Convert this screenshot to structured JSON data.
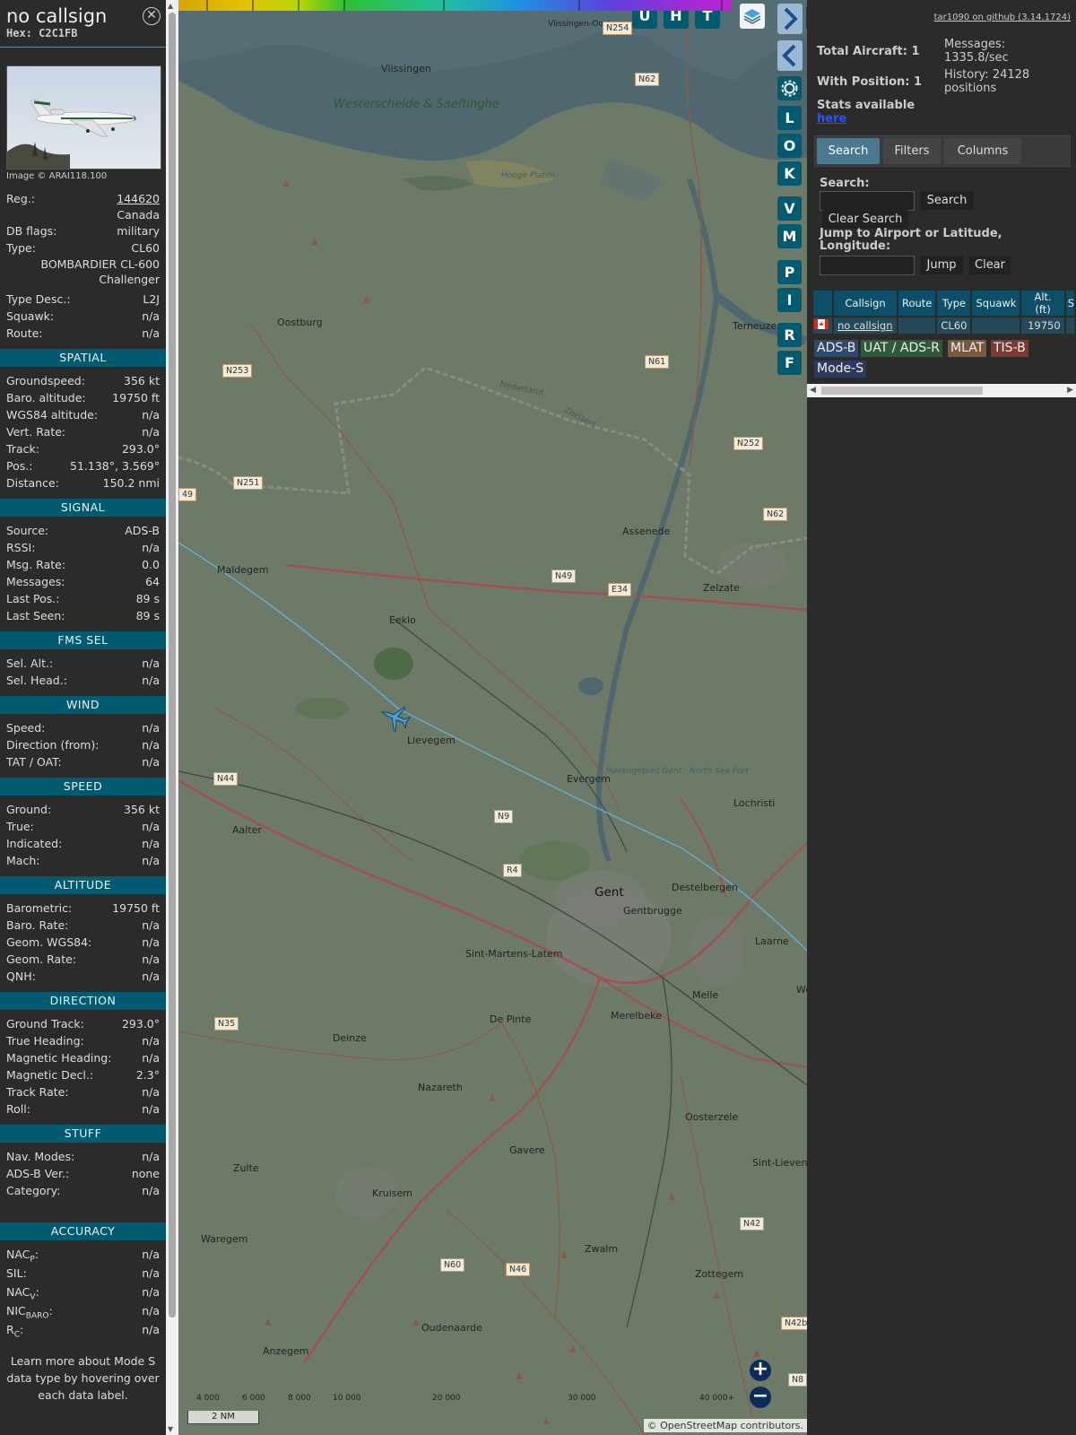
{
  "info": {
    "callsign": "no callsign",
    "hex": "Hex: C2C1FB",
    "image_credit": "Image © ARAI118.100",
    "reg_label": "Reg.:",
    "reg_value": "144620",
    "country": "Canada",
    "dbflags_label": "DB flags:",
    "dbflags_value": "military",
    "type_label": "Type:",
    "type_value": "CL60",
    "type_full": "BOMBARDIER CL-600 Challenger",
    "typedesc_label": "Type Desc.:",
    "typedesc_value": "L2J",
    "squawk_label": "Squawk:",
    "squawk_value": "n/a",
    "route_label": "Route:",
    "route_value": "n/a",
    "sections": {
      "spatial": "SPATIAL",
      "signal": "SIGNAL",
      "fms": "FMS SEL",
      "wind": "WIND",
      "speed": "SPEED",
      "altitude": "ALTITUDE",
      "direction": "DIRECTION",
      "stuff": "STUFF",
      "accuracy": "ACCURACY"
    },
    "spatial": [
      {
        "k": "Groundspeed:",
        "v": "356 kt"
      },
      {
        "k": "Baro. altitude:",
        "v": "19750 ft"
      },
      {
        "k": "WGS84 altitude:",
        "v": "n/a"
      },
      {
        "k": "Vert. Rate:",
        "v": "n/a"
      },
      {
        "k": "Track:",
        "v": "293.0°"
      },
      {
        "k": "Pos.:",
        "v": "51.138°, 3.569°"
      },
      {
        "k": "Distance:",
        "v": "150.2 nmi"
      }
    ],
    "signal": [
      {
        "k": "Source:",
        "v": "ADS-B"
      },
      {
        "k": "RSSI:",
        "v": "n/a"
      },
      {
        "k": "Msg. Rate:",
        "v": "0.0"
      },
      {
        "k": "Messages:",
        "v": "64"
      },
      {
        "k": "Last Pos.:",
        "v": "89 s"
      },
      {
        "k": "Last Seen:",
        "v": "89 s"
      }
    ],
    "fms": [
      {
        "k": "Sel. Alt.:",
        "v": "n/a"
      },
      {
        "k": "Sel. Head.:",
        "v": "n/a"
      }
    ],
    "wind": [
      {
        "k": "Speed:",
        "v": "n/a"
      },
      {
        "k": "Direction (from):",
        "v": "n/a"
      },
      {
        "k": "TAT / OAT:",
        "v": "n/a"
      }
    ],
    "speed": [
      {
        "k": "Ground:",
        "v": "356 kt"
      },
      {
        "k": "True:",
        "v": "n/a"
      },
      {
        "k": "Indicated:",
        "v": "n/a"
      },
      {
        "k": "Mach:",
        "v": "n/a"
      }
    ],
    "altitude": [
      {
        "k": "Barometric:",
        "v": "19750 ft"
      },
      {
        "k": "Baro. Rate:",
        "v": "n/a"
      },
      {
        "k": "Geom. WGS84:",
        "v": "n/a"
      },
      {
        "k": "Geom. Rate:",
        "v": "n/a"
      },
      {
        "k": "QNH:",
        "v": "n/a"
      }
    ],
    "direction": [
      {
        "k": "Ground Track:",
        "v": "293.0°"
      },
      {
        "k": "True Heading:",
        "v": "n/a"
      },
      {
        "k": "Magnetic Heading:",
        "v": "n/a"
      },
      {
        "k": "Magnetic Decl.:",
        "v": "2.3°"
      },
      {
        "k": "Track Rate:",
        "v": "n/a"
      },
      {
        "k": "Roll:",
        "v": "n/a"
      }
    ],
    "stuff": [
      {
        "k": "Nav. Modes:",
        "v": "n/a"
      },
      {
        "k": "ADS-B Ver.:",
        "v": "none"
      },
      {
        "k": "Category:",
        "v": "n/a"
      }
    ],
    "accuracy": [
      {
        "k": "NAC",
        "sub": "P",
        "v": "n/a"
      },
      {
        "k": "SIL:",
        "sub": "",
        "v": "n/a"
      },
      {
        "k": "NAC",
        "sub": "V",
        "v": "n/a"
      },
      {
        "k": "NIC",
        "sub": "BARO",
        "v": "n/a"
      },
      {
        "k": "R",
        "sub": "C",
        "v": "n/a"
      }
    ],
    "learn_more": "Learn more about Mode S data type by hovering over each data label."
  },
  "map": {
    "top_buttons": [
      "U",
      "H",
      "T"
    ],
    "side_buttons": [
      "L",
      "O",
      "K",
      "V",
      "M",
      "P",
      "I",
      "R",
      "F"
    ],
    "labels": {
      "westerschelde": "Westerschelde & Saeftinghe",
      "hooge_platen": "Hooge Platen",
      "vlissingen": "Vlissingen",
      "vlissingen_oost": "Vlissingen-Oost",
      "oostburg": "Oostburg",
      "terneuzen": "Terneuzen",
      "nederland": "Nederland",
      "zeeland": "Zeeland",
      "assenede": "Assenede",
      "maldegem": "Maldegem",
      "zelzate": "Zelzate",
      "eeklo": "Eeklo",
      "lievegem": "Lievegem",
      "evergem": "Evergem",
      "havengebied": "Havengebied Gent - North Sea Port",
      "lochristi": "Lochristi",
      "aalter": "Aalter",
      "gent": "Gent",
      "destelbergen": "Destelbergen",
      "gentbrugge": "Gentbrugge",
      "laarne": "Laarne",
      "sint_martens_latem": "Sint-Martens-Latem",
      "melle": "Melle",
      "de_pinte": "De Pinte",
      "merelbeke": "Merelbeke",
      "deinze": "Deinze",
      "nazareth": "Nazareth",
      "oosterzele": "Oosterzele",
      "zulte": "Zulte",
      "gavere": "Gavere",
      "sint_lievens_houtem": "Sint-Lievens-Houtem",
      "kruisem": "Kruisem",
      "waregem": "Waregem",
      "zwalm": "Zwalm",
      "zottegem": "Zottegem",
      "oudenaarde": "Oudenaarde",
      "anzegem": "Anzegem",
      "we": "We"
    },
    "shields": [
      "N254",
      "N62",
      "N253",
      "N61",
      "N252",
      "N251",
      "N62",
      "N49",
      "E34",
      "N44",
      "N9",
      "R4",
      "N35",
      "N42",
      "N60",
      "N46",
      "N42b",
      "N8",
      "49"
    ],
    "colorbar_ticks": [
      "4 000",
      "6 000",
      "8 000",
      "10 000",
      "20 000",
      "30 000",
      "40 000+"
    ],
    "scale": "2 NM",
    "attribution": "© OpenStreetMap contributors."
  },
  "right": {
    "github": "tar1090 on github (3.14.1724)",
    "total_aircraft": "Total Aircraft: 1",
    "with_position": "With Position: 1",
    "messages": "Messages: 1335.8/sec",
    "history": "History: 24128 positions",
    "stats_available": "Stats available",
    "here": "here",
    "tabs": [
      "Search",
      "Filters",
      "Columns"
    ],
    "search_label": "Search:",
    "search_btn": "Search",
    "clear_search": "Clear Search",
    "jump_label": "Jump to Airport or Latitude, Longitude:",
    "jump_btn": "Jump",
    "clear_btn": "Clear",
    "table": {
      "headers": [
        "",
        "Callsign",
        "Route",
        "Type",
        "Squawk",
        "Alt. (ft)",
        "S"
      ],
      "rows": [
        {
          "callsign": "no callsign",
          "route": "",
          "type": "CL60",
          "squawk": "",
          "alt": "19750"
        }
      ]
    },
    "tags": [
      "ADS-B",
      "UAT / ADS-R",
      "MLAT",
      "TIS-B",
      "Mode-S"
    ]
  }
}
